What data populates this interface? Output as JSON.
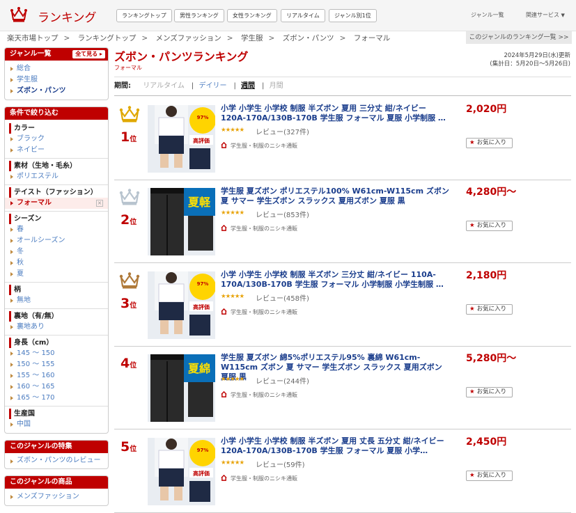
{
  "header": {
    "logo_text": "ランキング",
    "nav": [
      "ランキングトップ",
      "男性ランキング",
      "女性ランキング",
      "リアルタイム",
      "ジャンル別1位"
    ],
    "right": [
      "ジャンル一覧",
      "関連サービス"
    ]
  },
  "breadcrumb": [
    "楽天市場トップ",
    "ランキングトップ",
    "メンズファッション",
    "学生服",
    "ズボン・パンツ",
    "フォーマル"
  ],
  "genre_list_link": "このジャンルのランキング一覧 >>",
  "sidebar": {
    "genre": {
      "title": "ジャンル一覧",
      "see_all": "全て見る",
      "items": [
        "総合",
        "学生服",
        "ズボン・パンツ"
      ]
    },
    "filter": {
      "title": "条件で絞り込む",
      "sections": [
        {
          "title": "カラー",
          "items": [
            "ブラック",
            "ネイビー"
          ]
        },
        {
          "title": "素材（生地・毛糸）",
          "items": [
            "ポリエステル"
          ]
        },
        {
          "title": "テイスト（ファッション）",
          "items": [
            "フォーマル"
          ]
        },
        {
          "title": "シーズン",
          "items": [
            "春",
            "オールシーズン",
            "冬",
            "秋",
            "夏"
          ]
        },
        {
          "title": "柄",
          "items": [
            "無地"
          ]
        },
        {
          "title": "裏地（有/無）",
          "items": [
            "裏地あり"
          ]
        },
        {
          "title": "身長（cm）",
          "items": [
            "145 ～ 150",
            "150 ～ 155",
            "155 ～ 160",
            "160 ～ 165",
            "165 ～ 170"
          ]
        },
        {
          "title": "生産国",
          "items": [
            "中国"
          ]
        }
      ]
    },
    "feature": {
      "title": "このジャンルの特集",
      "items": [
        "ズボン・パンツのレビュー"
      ]
    },
    "products": {
      "title": "このジャンルの商品",
      "items": [
        "メンズファッション"
      ]
    }
  },
  "main": {
    "title": "ズボン・パンツランキング",
    "subtitle": "フォーマル",
    "update": "2024年5月29日(水)更新",
    "period_range": "(集計日：5月20日～5月26日)",
    "period_label": "期間:",
    "periods": [
      "リアルタイム",
      "デイリー",
      "週間",
      "月間"
    ],
    "period_sep": "|",
    "rank_suffix": "位"
  },
  "items": [
    {
      "rank": "1",
      "title": "小学 小学生 小学校 制服 半ズボン 夏用 三分丈 紺/ネイビー 120A-170A/130B-170B 学生服 フォーマル 夏服 小学制服 …",
      "stars": "★★★★★",
      "reviews": "レビュー(327件)",
      "shop": "学生服・制服のニシキ通販",
      "price": "2,020円",
      "fav": "お気に入り",
      "badge": "97%以上のお客様から高評価"
    },
    {
      "rank": "2",
      "title": "学生服 夏ズボン ポリエステル100% W61cm-W115cm ズボン 夏 サマー 学生ズボン スラックス 夏用ズボン 夏服 黒",
      "stars": "★★★★★",
      "reviews": "レビュー(853件)",
      "shop": "学生服・制服のニシキ通販",
      "price": "4,280円～",
      "fav": "お気に入り",
      "badge": "夏 軽"
    },
    {
      "rank": "3",
      "title": "小学 小学生 小学校 制服 半ズボン 三分丈 紺/ネイビー 110A-170A/130B-170B 学生服 フォーマル 小学制服 小学生制服 …",
      "stars": "★★★★★",
      "reviews": "レビュー(458件)",
      "shop": "学生服・制服のニシキ通販",
      "price": "2,180円",
      "fav": "お気に入り",
      "badge": "97%以上のお客様から高評価"
    },
    {
      "rank": "4",
      "title": "学生服 夏ズボン 綿5%ポリエステル95% 裏綿 W61cm-W115cm ズボン 夏 サマー 学生ズボン スラックス 夏用ズボン 夏服 黒",
      "stars": "★★★★★",
      "reviews": "レビュー(244件)",
      "shop": "学生服・制服のニシキ通販",
      "price": "5,280円～",
      "fav": "お気に入り",
      "badge": "夏 綿"
    },
    {
      "rank": "5",
      "title": "小学 小学生 小学校 制服 半ズボン 夏用 丈長 五分丈 紺/ネイビー 120A-170A/130B-170B 学生服 フォーマル 夏服 小学…",
      "stars": "★★★★★",
      "reviews": "レビュー(59件)",
      "shop": "学生服・制服のニシキ通販",
      "price": "2,450円",
      "fav": "お気に入り",
      "badge": "97%以上のお客様から高評価"
    }
  ],
  "colors": {
    "accent": "#bf0000",
    "link": "#1a3d8c",
    "gold": "#e0a800",
    "silver": "#b8c4cf",
    "bronze": "#b07a3a"
  }
}
